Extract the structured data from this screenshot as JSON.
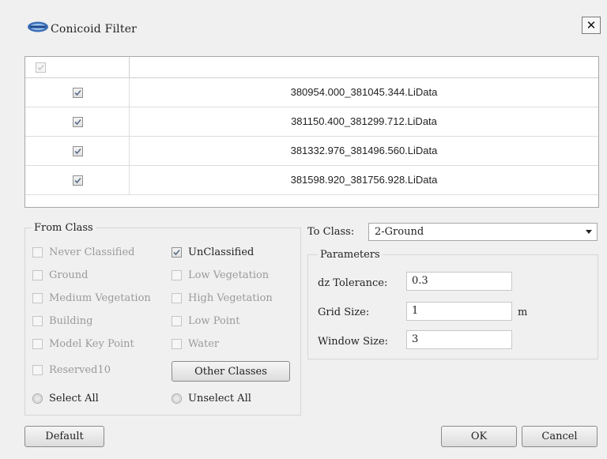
{
  "window": {
    "title": "Conicoid Filter",
    "close_symbol": "✕"
  },
  "file_table": {
    "header_checkbox_checked": true,
    "rows": [
      {
        "checked": true,
        "name": "380954.000_381045.344.LiData"
      },
      {
        "checked": true,
        "name": "381150.400_381299.712.LiData"
      },
      {
        "checked": true,
        "name": "381332.976_381496.560.LiData"
      },
      {
        "checked": true,
        "name": "381598.920_381756.928.LiData"
      }
    ]
  },
  "from_class": {
    "label": "From Class",
    "classes": [
      {
        "label": "Never Classified",
        "checked": false,
        "enabled": false
      },
      {
        "label": "UnClassified",
        "checked": true,
        "enabled": true
      },
      {
        "label": "Ground",
        "checked": false,
        "enabled": false
      },
      {
        "label": "Low Vegetation",
        "checked": false,
        "enabled": false
      },
      {
        "label": "Medium Vegetation",
        "checked": false,
        "enabled": false
      },
      {
        "label": "High Vegetation",
        "checked": false,
        "enabled": false
      },
      {
        "label": "Building",
        "checked": false,
        "enabled": false
      },
      {
        "label": "Low Point",
        "checked": false,
        "enabled": false
      },
      {
        "label": "Model Key Point",
        "checked": false,
        "enabled": false
      },
      {
        "label": "Water",
        "checked": false,
        "enabled": false
      },
      {
        "label": "Reserved10",
        "checked": false,
        "enabled": false
      }
    ],
    "other_classes_label": "Other Classes",
    "select_all_label": "Select All",
    "unselect_all_label": "Unselect All"
  },
  "to_class": {
    "label": "To Class:",
    "value": "2-Ground"
  },
  "parameters": {
    "label": "Parameters",
    "dz_tolerance": {
      "label": "dz Tolerance:",
      "value": "0.3"
    },
    "grid_size": {
      "label": "Grid Size:",
      "value": "1",
      "unit": "m"
    },
    "window_size": {
      "label": "Window Size:",
      "value": "3"
    }
  },
  "buttons": {
    "default": "Default",
    "ok": "OK",
    "cancel": "Cancel"
  }
}
